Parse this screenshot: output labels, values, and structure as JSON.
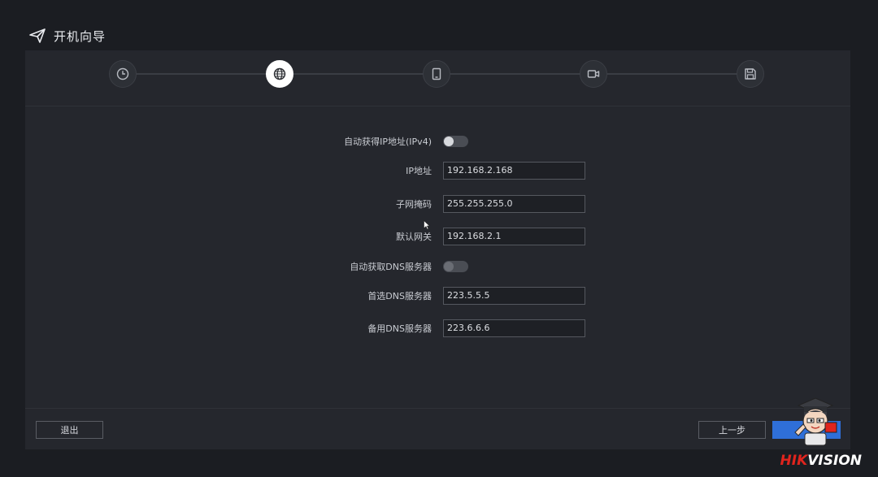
{
  "window": {
    "title": "开机向导",
    "title_icon": "send-icon"
  },
  "stepper": {
    "steps": [
      {
        "name": "time",
        "icon": "clock-icon",
        "active": false
      },
      {
        "name": "network",
        "icon": "globe-icon",
        "active": true
      },
      {
        "name": "device",
        "icon": "tablet-icon",
        "active": false
      },
      {
        "name": "camera",
        "icon": "video-icon",
        "active": false
      },
      {
        "name": "storage",
        "icon": "save-icon",
        "active": false
      }
    ]
  },
  "form": {
    "auto_ip_label": "自动获得IP地址(IPv4)",
    "auto_ip_enabled": false,
    "ip_label": "IP地址",
    "ip_value": "192.168.2.168",
    "mask_label": "子网掩码",
    "mask_value": "255.255.255.0",
    "gateway_label": "默认网关",
    "gateway_value": "192.168.2.1",
    "auto_dns_label": "自动获取DNS服务器",
    "auto_dns_enabled": false,
    "dns1_label": "首选DNS服务器",
    "dns1_value": "223.5.5.5",
    "dns2_label": "备用DNS服务器",
    "dns2_value": "223.6.6.6"
  },
  "footer": {
    "exit_label": "退出",
    "prev_label": "上一步",
    "next_label": ""
  },
  "branding": {
    "part1": "HIK",
    "part2": "VISION",
    "accent": "#e0241d",
    "primary": "#2f6fd8"
  }
}
